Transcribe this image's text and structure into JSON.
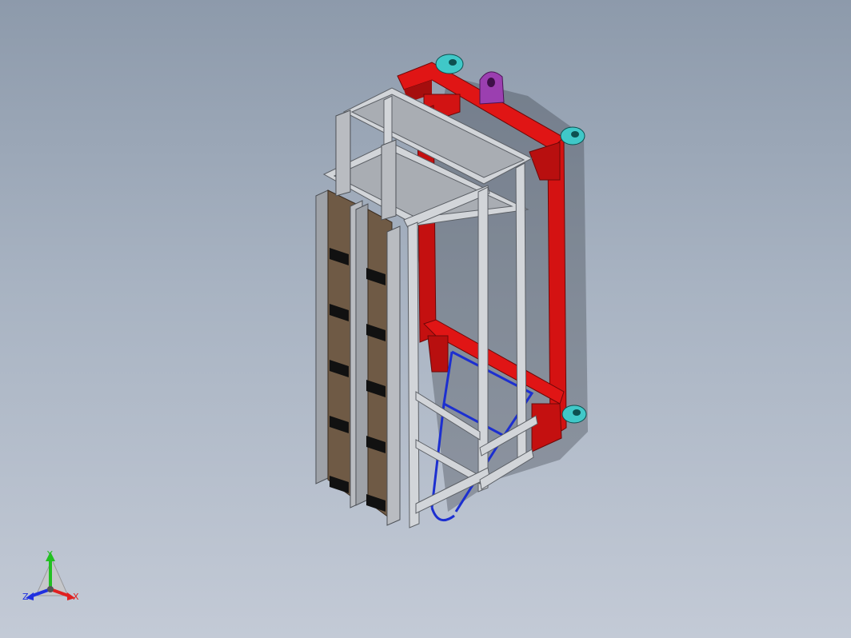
{
  "viewport": {
    "background_top": "#8d9aab",
    "background_bottom": "#c3cad6"
  },
  "colors": {
    "frame_steel": "#c9ccd0",
    "frame_steel_dark": "#8e9297",
    "red_frame": "#e01515",
    "red_frame_dark": "#8c0a0a",
    "caster_cyan": "#40c8c8",
    "lifting_lug_purple": "#9b3fb0",
    "wood_panel": "#6f5a45",
    "blue_brace": "#1c2fd0",
    "clamp_black": "#111111"
  },
  "triad": {
    "x_label": "X",
    "y_label": "Y",
    "z_label": "Z",
    "x_color": "#e02020",
    "y_color": "#22c022",
    "z_color": "#2030e0"
  }
}
